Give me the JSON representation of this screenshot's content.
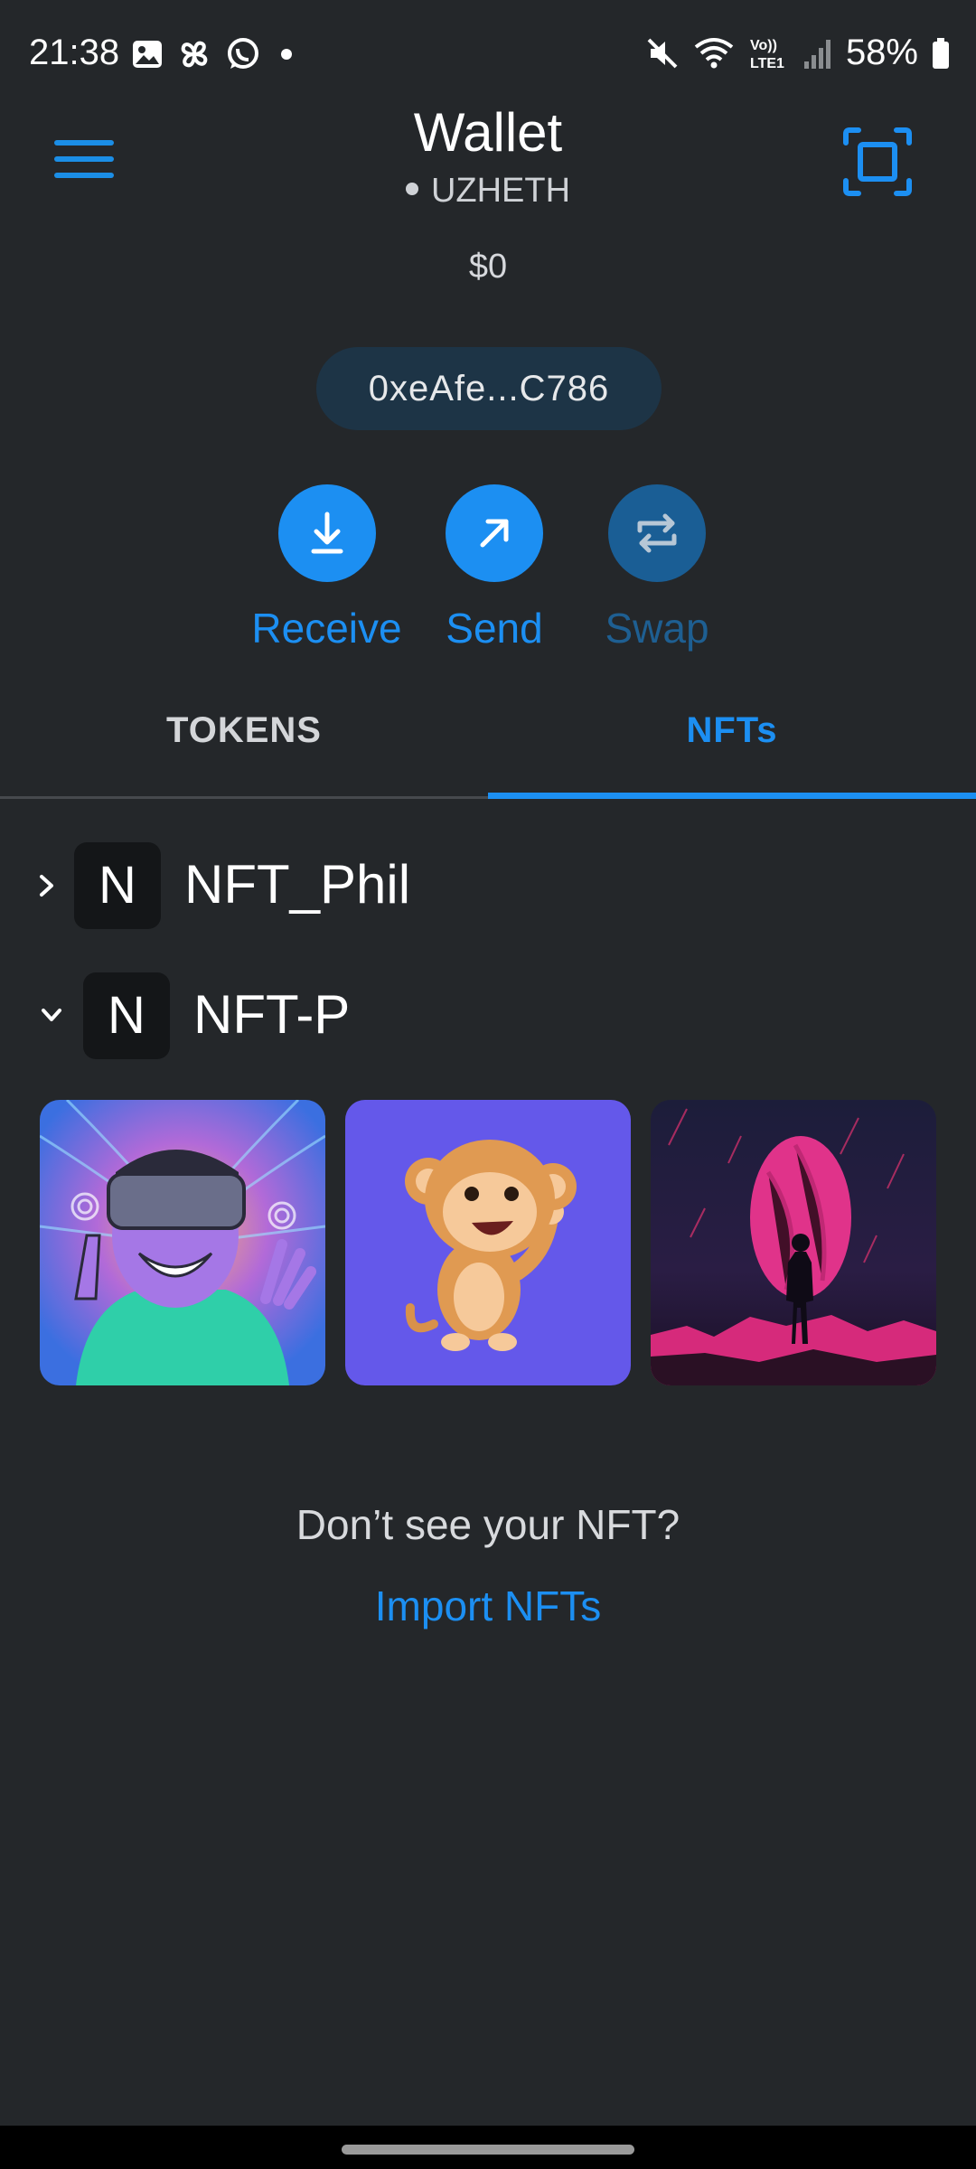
{
  "status_bar": {
    "time": "21:38",
    "battery": "58%",
    "left_icons": [
      "gallery-icon",
      "pinwheel-icon",
      "whatsapp-icon",
      "dot-icon"
    ],
    "right_icons": [
      "mute-icon",
      "wifi-icon",
      "volte-icon",
      "signal-icon",
      "battery-icon"
    ],
    "volte_text": "Vo))\nLTE1"
  },
  "header": {
    "title": "Wallet",
    "network": "UZHETH",
    "balance": "$0",
    "address": "0xeAfe...C786"
  },
  "actions": [
    {
      "label": "Receive",
      "icon": "download-icon",
      "enabled": true
    },
    {
      "label": "Send",
      "icon": "arrow-up-right-icon",
      "enabled": true
    },
    {
      "label": "Swap",
      "icon": "swap-icon",
      "enabled": false
    }
  ],
  "tabs": {
    "items": [
      {
        "label": "TOKENS"
      },
      {
        "label": "NFTs"
      }
    ],
    "selected": "NFTs"
  },
  "collections": [
    {
      "name": "NFT_Phil",
      "avatar_letter": "N",
      "expanded": false
    },
    {
      "name": "NFT-P",
      "avatar_letter": "N",
      "expanded": true
    }
  ],
  "nfts": [
    {
      "image": "vr-headset-character"
    },
    {
      "image": "cartoon-monkey"
    },
    {
      "image": "silhouette-portal"
    }
  ],
  "empty_state": {
    "question": "Don’t see your NFT?",
    "link": "Import NFTs"
  },
  "colors": {
    "background": "#24272a",
    "accent": "#1c8ff2",
    "disabled_accent": "#1a5e95"
  }
}
